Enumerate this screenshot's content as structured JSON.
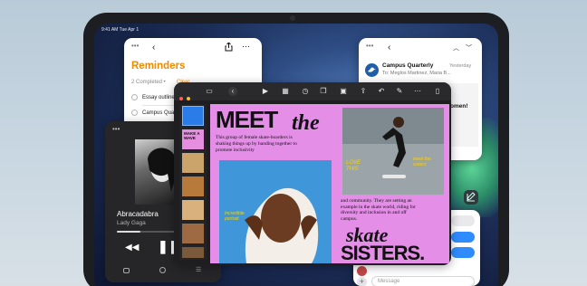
{
  "status_bar": {
    "time": "9:41 AM  Tue Apr 1"
  },
  "reminders": {
    "title": "Reminders",
    "completed": "2 Completed •",
    "clear": "Clear",
    "items": [
      "Essay outline",
      "Campus Quarterly"
    ]
  },
  "mail": {
    "from": "Campus Quarterly",
    "to": "To: Meglos Martinez, Maria B...",
    "time": "Yesterday",
    "body_text": "women!"
  },
  "music": {
    "song": "Abracadabra",
    "artist": "Lady Gaga"
  },
  "freeform": {
    "headline_left": "MEET",
    "headline_the": "the",
    "intro": "This group of female skate-boarders is shaking things up by banding together to promote inclusivity",
    "sidebar_make": "MAKE A WAVE",
    "body_right": "and community. They are setting an example in the skate world, riding for diversity and inclusion in and off campus.",
    "skate": "skate",
    "sisters": "SISTERS.",
    "love_this": "LOVE THIS",
    "photo_note": "Incredible portrait",
    "corner_note": "meet the sisters"
  },
  "messages": {
    "placeholder": "Message"
  }
}
